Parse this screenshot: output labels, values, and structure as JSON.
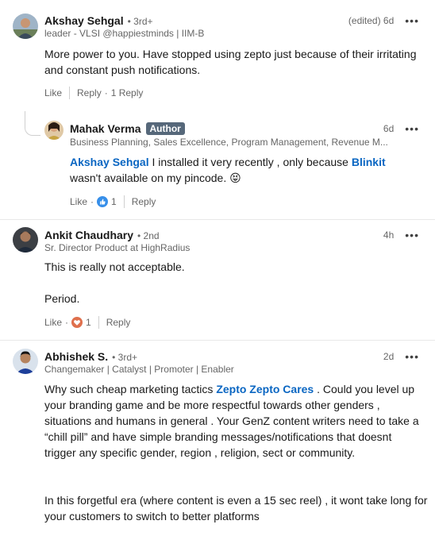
{
  "comments": [
    {
      "name": "Akshay Sehgal",
      "degree": "• 3rd+",
      "headline": "leader - VLSI @happiestminds | IIM-B",
      "time": "(edited) 6d",
      "text": "More power to you. Have stopped using zepto just because of their irritating and constant push notifications.",
      "like": "Like",
      "reply": "Reply",
      "reply_count": "1 Reply"
    },
    {
      "name": "Mahak Verma",
      "badge": "Author",
      "headline": "Business Planning, Sales Excellence, Program Management, Revenue M...",
      "time": "6d",
      "mention1": "Akshay Sehgal",
      "text_a": " I installed it very recently , only because ",
      "mention2": "Blinkit",
      "text_b": " wasn't available on my pincode. ",
      "emoji": "😝",
      "like": "Like",
      "reaction_count": "1",
      "reply": "Reply"
    },
    {
      "name": "Ankit Chaudhary",
      "degree": "• 2nd",
      "headline": "Sr. Director Product at HighRadius",
      "time": "4h",
      "para1": "This is really not acceptable.",
      "para2": "Period.",
      "like": "Like",
      "reaction_count": "1",
      "reply": "Reply"
    },
    {
      "name": "Abhishek S.",
      "degree": "• 3rd+",
      "headline": "Changemaker | Catalyst | Promoter | Enabler",
      "time": "2d",
      "text_a": "Why such cheap marketing tactics ",
      "mention": "Zepto Zepto Cares",
      "text_b": " . Could you level up your branding game and be more respectful towards other genders , situations and humans in general . Your GenZ content writers need to take a “chill pill” and have simple branding messages/notifications that doesnt trigger any specific gender, region , religion, sect or community.",
      "para2": "In this forgetful era (where content is even a 15 sec reel) , it wont take long for your customers to switch to better platforms"
    }
  ],
  "icons": {
    "more": "more-options-icon",
    "like_reaction": "like-reaction-icon",
    "love_reaction": "love-reaction-icon"
  },
  "colors": {
    "link": "#0a66c2",
    "secondary_text": "#666666",
    "author_badge": "#56687a",
    "love": "#df704d",
    "like": "#378fe9"
  }
}
